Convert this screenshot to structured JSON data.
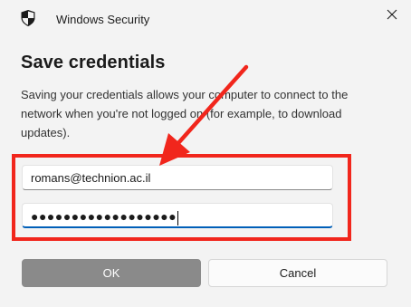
{
  "window": {
    "title": "Windows Security",
    "close_icon": "close-icon",
    "app_icon": "shield-icon"
  },
  "dialog": {
    "heading": "Save credentials",
    "description": "Saving your credentials allows your computer to connect to the network when you're not logged on (for example, to download updates)."
  },
  "fields": {
    "username_value": "romans@technion.ac.il",
    "password_value": "●●●●●●●●●●●●●●●●●●"
  },
  "buttons": {
    "ok_label": "OK",
    "cancel_label": "Cancel"
  },
  "annotation": {
    "color": "#f1261c",
    "arrow_icon": "arrow-icon"
  },
  "colors": {
    "background": "#f3f3f3",
    "accent": "#005fb8"
  }
}
